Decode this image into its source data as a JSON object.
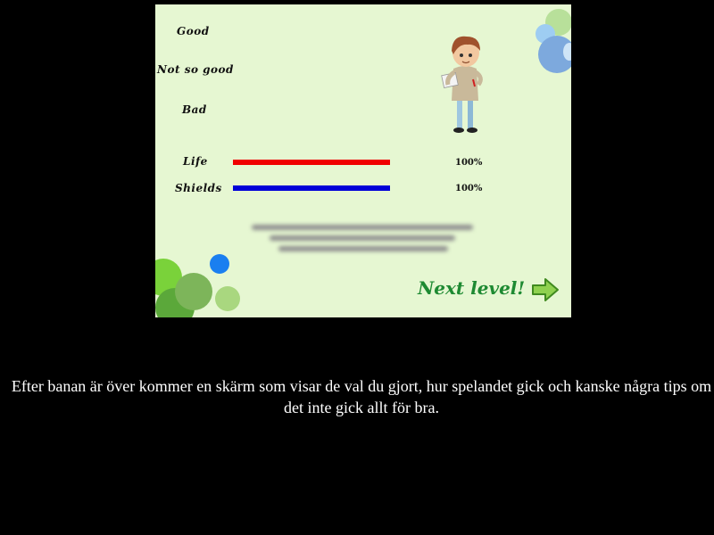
{
  "screen": {
    "category_good": "Good",
    "category_not_so_good": "Not so good",
    "category_bad": "Bad",
    "life": {
      "label": "Life",
      "value_text": "100%",
      "value": 1.0,
      "color": "#f00000"
    },
    "shields": {
      "label": "Shields",
      "value_text": "100%",
      "value": 1.0,
      "color": "#0000d8"
    },
    "tips_text": "(blurred, unreadable text)",
    "next_level_label": "Next level!",
    "next_arrow_icon": "right-arrow-icon",
    "character_icon": "boy-with-notepad-icon"
  },
  "caption": "Efter banan är över kommer en skärm som visar de val du gjort, hur spelandet gick och kanske några tips om det inte gick allt för bra.",
  "colors": {
    "background": "#000000",
    "panel": "#e6f7d2",
    "next_level": "#1e8a32"
  }
}
